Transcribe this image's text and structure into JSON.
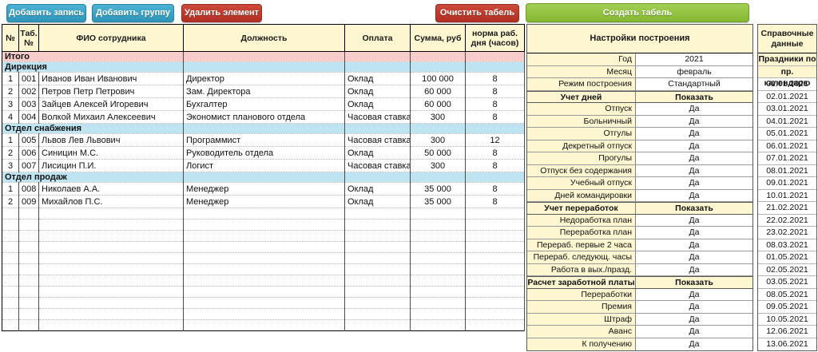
{
  "toolbar": {
    "add_record": "Добавить запись",
    "add_group": "Добавить группу",
    "delete_element": "Удалить элемент",
    "clear_timesheet": "Очистить табель",
    "create_timesheet": "Создать табель"
  },
  "colors": {
    "header_yellow": "#fdf6d0",
    "total_pink": "#f8cccb",
    "group_blue": "#bee3f1",
    "button_blue": "#2f95ba",
    "button_red": "#b23023",
    "button_green": "#85b931"
  },
  "employee_table": {
    "headers": [
      "№",
      "Таб. №",
      "ФИО сотрудника",
      "Должность",
      "Оплата",
      "Сумма, руб",
      "норма раб. дня (часов)"
    ],
    "total_label": "Итого",
    "groups": [
      {
        "name": "Дирекция",
        "rows": [
          {
            "num": "1",
            "tab": "001",
            "fio": "Иванов Иван Иванович",
            "position": "Директор",
            "pay": "Оклад",
            "sum": "100 000",
            "norm": "8"
          },
          {
            "num": "2",
            "tab": "002",
            "fio": "Петров Петр Петрович",
            "position": "Зам. Директора",
            "pay": "Оклад",
            "sum": "60 000",
            "norm": "8"
          },
          {
            "num": "3",
            "tab": "003",
            "fio": "Зайцев Алексей Игоревич",
            "position": "Бухгалтер",
            "pay": "Оклад",
            "sum": "60 000",
            "norm": "8"
          },
          {
            "num": "4",
            "tab": "004",
            "fio": "Волкой Михаил Алексеевич",
            "position": "Экономист планового отдела",
            "pay": "Часовая ставка",
            "sum": "300",
            "norm": "8"
          }
        ]
      },
      {
        "name": "Отдел снабжения",
        "rows": [
          {
            "num": "1",
            "tab": "005",
            "fio": "Львов Лев Львович",
            "position": "Программист",
            "pay": "Часовая ставка",
            "sum": "300",
            "norm": "12"
          },
          {
            "num": "2",
            "tab": "006",
            "fio": "Синицин М.С.",
            "position": "Руководитель отдела",
            "pay": "Оклад",
            "sum": "50 000",
            "norm": "8"
          },
          {
            "num": "3",
            "tab": "007",
            "fio": "Лисицин П.И.",
            "position": "Логист",
            "pay": "Часовая ставка",
            "sum": "300",
            "norm": "8"
          }
        ]
      },
      {
        "name": "Отдел продаж",
        "rows": [
          {
            "num": "1",
            "tab": "008",
            "fio": "Николаев А.А.",
            "position": "Менеджер",
            "pay": "Оклад",
            "sum": "35 000",
            "norm": "8"
          },
          {
            "num": "2",
            "tab": "009",
            "fio": "Михайлов П.С.",
            "position": "Менеджер",
            "pay": "Оклад",
            "sum": "35 000",
            "norm": "8"
          }
        ]
      }
    ],
    "empty_row_count": 11
  },
  "settings_panel": {
    "title": "Настройки построения",
    "rows": [
      {
        "label": "Год",
        "value": "2021",
        "type": "input"
      },
      {
        "label": "Месяц",
        "value": "февраль",
        "type": "input"
      },
      {
        "label": "Режим построения",
        "value": "Стандартный",
        "type": "input"
      },
      {
        "label": "Учет дней",
        "value": "Показать",
        "type": "section"
      },
      {
        "label": "Отпуск",
        "value": "Да",
        "type": "flag"
      },
      {
        "label": "Больничный",
        "value": "Да",
        "type": "flag"
      },
      {
        "label": "Отгулы",
        "value": "Да",
        "type": "flag"
      },
      {
        "label": "Декретный отпуск",
        "value": "Да",
        "type": "flag"
      },
      {
        "label": "Прогулы",
        "value": "Да",
        "type": "flag"
      },
      {
        "label": "Отпуск без содержания",
        "value": "Да",
        "type": "flag"
      },
      {
        "label": "Учебный отпуск",
        "value": "Да",
        "type": "flag"
      },
      {
        "label": "Дней командировки",
        "value": "Да",
        "type": "flag"
      },
      {
        "label": "Учет переработок",
        "value": "Показать",
        "type": "section"
      },
      {
        "label": "Недоработка план",
        "value": "Да",
        "type": "flag"
      },
      {
        "label": "Переработка план",
        "value": "Да",
        "type": "flag"
      },
      {
        "label": "Перераб. первые 2 часа",
        "value": "Да",
        "type": "flag"
      },
      {
        "label": "Перераб. следующ. часы",
        "value": "Да",
        "type": "flag"
      },
      {
        "label": "Работа в вых./празд.",
        "value": "Да",
        "type": "flag"
      },
      {
        "label": "Расчет заработной платы",
        "value": "Показать",
        "type": "section"
      },
      {
        "label": "Переработки",
        "value": "Да",
        "type": "flag"
      },
      {
        "label": "Премия",
        "value": "Да",
        "type": "flag"
      },
      {
        "label": "Штраф",
        "value": "Да",
        "type": "flag"
      },
      {
        "label": "Аванс",
        "value": "Да",
        "type": "flag"
      },
      {
        "label": "К получению",
        "value": "Да",
        "type": "flag"
      }
    ]
  },
  "reference_panel": {
    "title_line1": "Справочные",
    "title_line2": "данные",
    "subtitle_line1": "Праздники по",
    "subtitle_line2": "пр. календарю",
    "dates": [
      "01.01.2021",
      "02.01.2021",
      "03.01.2021",
      "04.01.2021",
      "05.01.2021",
      "06.01.2021",
      "07.01.2021",
      "08.01.2021",
      "09.01.2021",
      "10.01.2021",
      "21.02.2021",
      "22.02.2021",
      "23.02.2021",
      "08.03.2021",
      "01.05.2021",
      "02.05.2021",
      "03.05.2021",
      "08.05.2021",
      "09.05.2021",
      "10.05.2021",
      "12.06.2021",
      "13.06.2021"
    ]
  }
}
